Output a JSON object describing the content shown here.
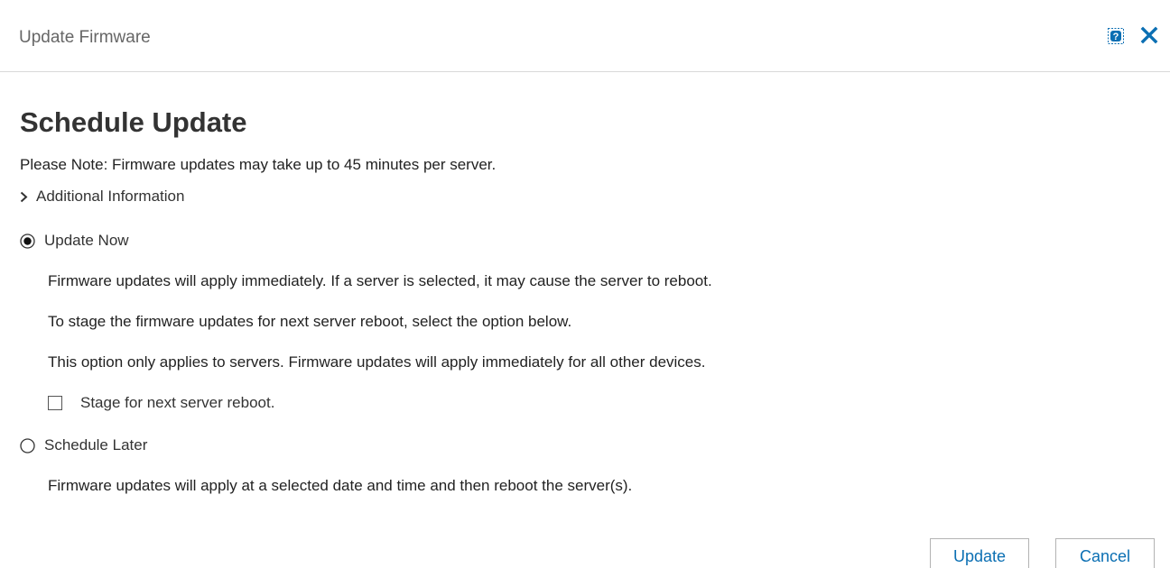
{
  "header": {
    "title": "Update Firmware",
    "help_icon": "help-icon",
    "close_icon": "close-icon",
    "accent": "#0b6fb3"
  },
  "main": {
    "title": "Schedule Update",
    "note": "Please Note: Firmware updates may take up to 45 minutes per server.",
    "additional_info_label": "Additional Information",
    "options": {
      "update_now": {
        "label": "Update Now",
        "selected": true,
        "descriptions": [
          "Firmware updates will apply immediately. If a server is selected, it may cause the server to reboot.",
          "To stage the firmware updates for next server reboot, select the option below.",
          "This option only applies to servers. Firmware updates will apply immediately for all other devices."
        ],
        "stage_checkbox": {
          "label": "Stage for next server reboot.",
          "checked": false
        }
      },
      "schedule_later": {
        "label": "Schedule Later",
        "selected": false,
        "description": "Firmware updates will apply at a selected date and time and then reboot the server(s)."
      }
    }
  },
  "footer": {
    "update_label": "Update",
    "cancel_label": "Cancel"
  }
}
